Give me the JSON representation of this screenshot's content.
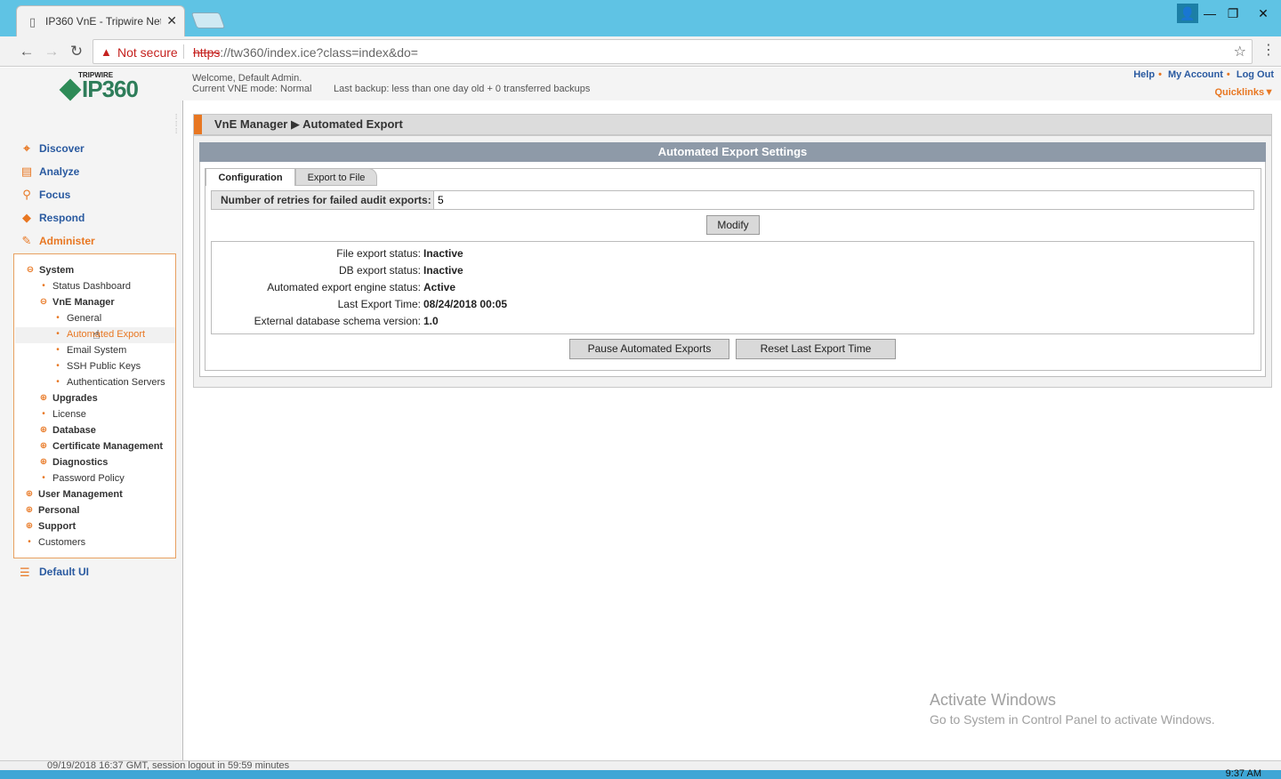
{
  "browser": {
    "tab_title": "IP360 VnE - Tripwire Netw",
    "not_secure": "Not secure",
    "url_scheme": "https",
    "url_rest": "://tw360/index.ice?class=index&do="
  },
  "header": {
    "brand_top": "TRIPWIRE",
    "brand_name": "IP360",
    "welcome": "Welcome, Default Admin.",
    "mode": "Current VNE mode: Normal",
    "backup": "Last backup: less than one day old  + 0 transferred backups",
    "links": [
      "Help",
      "My Account",
      "Log Out"
    ],
    "quicklinks": "Quicklinks▼"
  },
  "nav": {
    "items": [
      {
        "label": "Discover",
        "icon": "discover-icon",
        "glyph": "⌖"
      },
      {
        "label": "Analyze",
        "icon": "analyze-icon",
        "glyph": "▤"
      },
      {
        "label": "Focus",
        "icon": "focus-icon",
        "glyph": "⚲"
      },
      {
        "label": "Respond",
        "icon": "respond-icon",
        "glyph": "◆"
      },
      {
        "label": "Administer",
        "icon": "administer-icon",
        "glyph": "✎"
      }
    ],
    "default_ui": "Default UI"
  },
  "tree": {
    "system": "System",
    "status_dashboard": "Status Dashboard",
    "vne_manager": "VnE Manager",
    "general": "General",
    "automated_export": "Automated Export",
    "email_system": "Email System",
    "ssh_keys": "SSH Public Keys",
    "auth_servers": "Authentication Servers",
    "upgrades": "Upgrades",
    "license": "License",
    "database": "Database",
    "cert_mgmt": "Certificate Management",
    "diagnostics": "Diagnostics",
    "password_policy": "Password Policy",
    "user_mgmt": "User Management",
    "personal": "Personal",
    "support": "Support",
    "customers": "Customers"
  },
  "content": {
    "breadcrumb_parent": "VnE Manager",
    "breadcrumb_current": "Automated Export",
    "panel_title": "Automated Export Settings",
    "tab_config": "Configuration",
    "tab_export": "Export to File",
    "retries_label": "Number of retries for failed audit exports:",
    "retries_value": "5",
    "modify": "Modify",
    "statuses": [
      {
        "label": "File export status:",
        "value": "Inactive"
      },
      {
        "label": "DB export status:",
        "value": "Inactive"
      },
      {
        "label": "Automated export engine status:",
        "value": "Active"
      },
      {
        "label": "Last Export Time:",
        "value": "08/24/2018 00:05"
      },
      {
        "label": "External database schema version:",
        "value": "1.0"
      }
    ],
    "pause": "Pause Automated Exports",
    "reset": "Reset Last Export Time"
  },
  "footer": {
    "session": "09/19/2018 16:37 GMT, session logout in  59:59 minutes",
    "clock": "9:37 AM"
  },
  "watermark": {
    "line1": "Activate Windows",
    "line2": "Go to System in Control Panel to activate Windows."
  }
}
